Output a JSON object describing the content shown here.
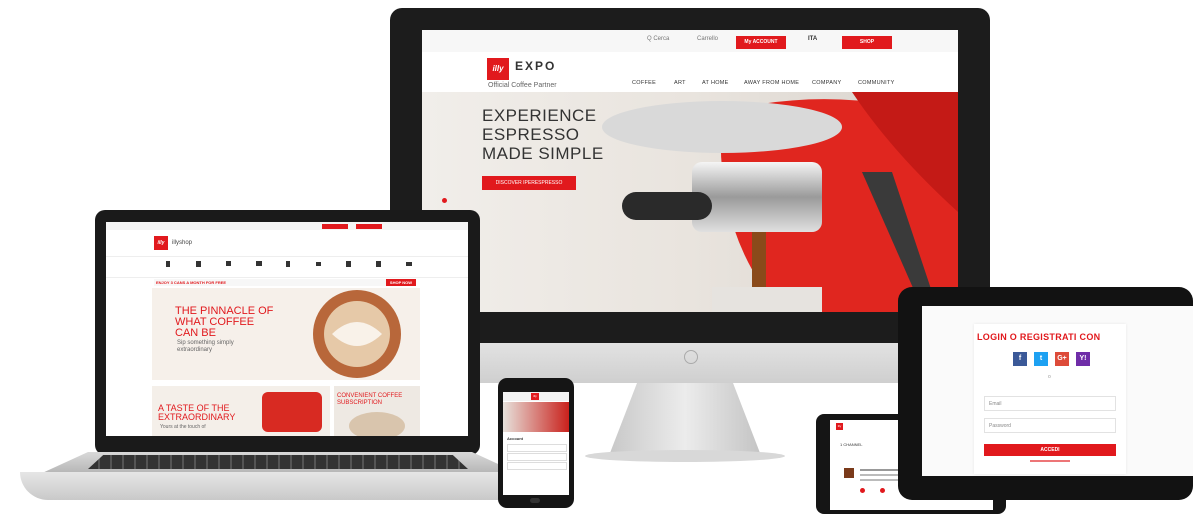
{
  "imac": {
    "brand": "illy",
    "expo_logo": "EXPO",
    "partner_text": "Official Coffee Partner",
    "top_bar": {
      "search": "Q Cerca",
      "cart": "Carrello",
      "account_btn": "My ACCOUNT",
      "country": "ITA",
      "shop_btn": "SHOP"
    },
    "nav": [
      "COFFEE",
      "ART",
      "AT HOME",
      "AWAY FROM HOME",
      "COMPANY",
      "COMMUNITY"
    ],
    "hero": {
      "line1": "EXPERIENCE",
      "line2": "ESPRESSO",
      "line3": "MADE SIMPLE",
      "cta": "DISCOVER IPERESPRESSO"
    }
  },
  "laptop": {
    "brand": "illy",
    "logo_text": "illyshop",
    "banner": "ENJOY 3 CANS A MONTH FOR FREE",
    "banner_btn": "SHOP NOW",
    "hero_title_1": "THE PINNACLE OF",
    "hero_title_2": "WHAT COFFEE",
    "hero_title_3": "CAN BE",
    "hero_sub_1": "Sip something simply",
    "hero_sub_2": "extraordinary",
    "taste_1": "A TASTE OF THE",
    "taste_2": "EXTRAORDINARY",
    "taste_sub": "Yours at the touch of",
    "convenient_1": "CONVENIENT COFFEE",
    "convenient_2": "SUBSCRIPTION"
  },
  "phone": {
    "brand": "illy",
    "section": "Account"
  },
  "small_tablet": {
    "brand": "illy",
    "title": "1 CHANNEL"
  },
  "big_tablet": {
    "title": "LOGIN O REGISTRATI CON",
    "social": [
      "f",
      "t",
      "G+",
      "Y!"
    ],
    "or_text": "o",
    "email_placeholder": "Email",
    "password_placeholder": "Password",
    "submit": "ACCEDI"
  },
  "colors": {
    "brand_red": "#e1191d",
    "facebook": "#3b5998",
    "twitter": "#1da1f2",
    "google": "#dd4b39",
    "yahoo": "#6f2da8"
  }
}
